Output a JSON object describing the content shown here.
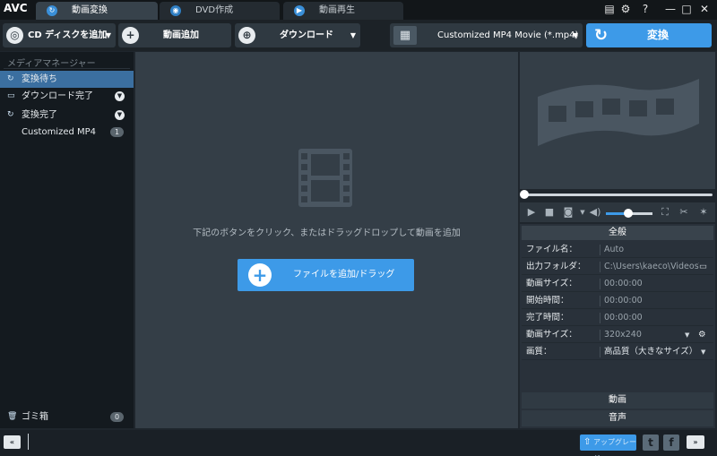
{
  "app": {
    "logo": "AVC"
  },
  "tabs": [
    {
      "label": "動画変換",
      "icon": "convert-icon"
    },
    {
      "label": "DVD作成",
      "icon": "disc-icon"
    },
    {
      "label": "動画再生",
      "icon": "play-icon"
    }
  ],
  "window_buttons": [
    "menu-icon",
    "gear-icon",
    "help-icon",
    "minimize-icon",
    "maximize-icon",
    "close-icon"
  ],
  "toolbar": {
    "cd_button": "CD ディスクを追加",
    "add_video": "動画追加",
    "download": "ダウンロード",
    "format": "Customized MP4 Movie (*.mp4)",
    "convert": "変換"
  },
  "sidebar": {
    "header": "メディアマネージャー",
    "items": [
      {
        "label": "変換待ち"
      },
      {
        "label": "ダウンロード完了"
      },
      {
        "label": "変換完了"
      },
      {
        "label": "Customized MP4",
        "count": "1"
      }
    ],
    "trash": {
      "label": "ゴミ箱",
      "count": "0"
    }
  },
  "main": {
    "hint": "下記のボタンをクリック、またはドラッグドロップして動画を追加",
    "add_button": "ファイルを追加/ドラッグ"
  },
  "player": {
    "progress": 0.0,
    "volume": 0.45
  },
  "properties": {
    "header": "全般",
    "rows": [
      {
        "key": "ファイル名：",
        "value": "Auto"
      },
      {
        "key": "出力フォルダ：",
        "value": "C:\\Users\\kaeco\\Videos\\..."
      },
      {
        "key": "動画サイズ：",
        "value": "00:00:00"
      },
      {
        "key": "開始時間：",
        "value": "00:00:00"
      },
      {
        "key": "完了時間：",
        "value": "00:00:00"
      },
      {
        "key": "動画サイズ：",
        "value": "320x240"
      },
      {
        "key": "画質：",
        "value": "高品質（大きなサイズ）"
      }
    ],
    "sections": [
      "動画",
      "音声"
    ]
  },
  "bottom": {
    "collapse": "«",
    "expand": "»",
    "upgrade": "アップグレード"
  },
  "colors": {
    "accent": "#3d9ae8",
    "sidebar_active": "#3b6fa0",
    "panel": "#343e47"
  }
}
